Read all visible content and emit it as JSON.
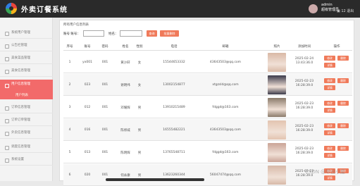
{
  "app": {
    "title": "外卖订餐系统"
  },
  "header": {
    "username": "admin",
    "role": "超级管理员",
    "messages": "▣ 12",
    "logout": "退出"
  },
  "sidebar": {
    "items": [
      {
        "label": "系统用户管理"
      },
      {
        "label": "公告栏管理"
      },
      {
        "label": "美食菜品管理"
      },
      {
        "label": "美食信息管理"
      },
      {
        "label": "用户信息管理"
      },
      {
        "label": "订单信息管理"
      },
      {
        "label": "订单订单管理"
      },
      {
        "label": "外卖信息管理"
      },
      {
        "label": "调度信息管理"
      },
      {
        "label": "系统设置"
      }
    ],
    "active_sub": "用户列表"
  },
  "main": {
    "title": "所有用户信息列表",
    "search": {
      "label1": "账号 账号：",
      "label2": "姓名：",
      "btn_search": "查询",
      "btn_delete": "批量删除"
    },
    "table": {
      "headers": [
        "序号",
        "账号",
        "密码",
        "姓名",
        "性别",
        "电话",
        "邮箱",
        "照片",
        "添加时间",
        "操作"
      ],
      "rows": [
        {
          "no": "1",
          "account": "yx001",
          "password": "001",
          "name": "黄沙轩",
          "gender": "女",
          "phone": "15544653332",
          "email": "43643503@qq.com",
          "time1": "2025-02-24",
          "time2": "13:43:36.0"
        },
        {
          "no": "2",
          "account": "023",
          "password": "001",
          "name": "谢明纬",
          "gender": "女",
          "phone": "13002154877",
          "email": "xtgzsld@qq.com",
          "time1": "2025-02-23",
          "time2": "16:28:39.0"
        },
        {
          "no": "3",
          "account": "012",
          "password": "001",
          "name": "邓耀辉",
          "gender": "男",
          "phone": "13910215489",
          "email": "fdggd@163.com",
          "time1": "2025-02-23",
          "time2": "16:28:39.0"
        },
        {
          "no": "4",
          "account": "016",
          "password": "001",
          "name": "陈修威",
          "gender": "男",
          "phone": "16555482221",
          "email": "43643503@qq.com",
          "time1": "2025-02-23",
          "time2": "16:28:39.0"
        },
        {
          "no": "5",
          "account": "013",
          "password": "001",
          "name": "陈明辉",
          "gender": "男",
          "phone": "13765548711",
          "email": "fdggd@163.com",
          "time1": "2025-02-23",
          "time2": "16:28:39.0"
        },
        {
          "no": "6",
          "account": "020",
          "password": "001",
          "name": "何永康",
          "gender": "男",
          "phone": "13623260344",
          "email": "56047474@qq.com",
          "time1": "2025-02-23",
          "time2": "16:28:39.0"
        }
      ],
      "op_labels": {
        "edit": "修改",
        "delete": "删除",
        "detail": "详情"
      }
    }
  },
  "watermark": "CSDN @毕设小屋",
  "colors": {
    "accent": "#f26a6a",
    "button": "#f07a5a",
    "topbar": "#2a2a2a"
  }
}
